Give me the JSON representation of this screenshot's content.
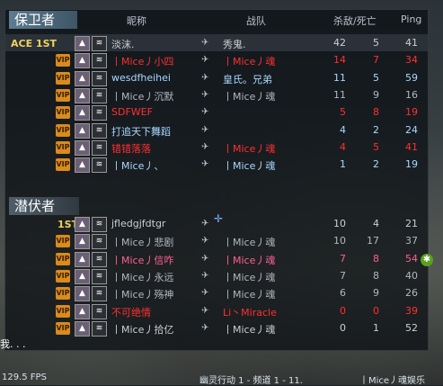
{
  "headers": {
    "nickname": "昵称",
    "clan": "战队",
    "kd": "杀敌/死亡",
    "ping": "Ping"
  },
  "teams": [
    {
      "title": "保卫者",
      "players": [
        {
          "prefix": "ACE 1ST",
          "name": "淡沫.",
          "clan": "秀鬼.",
          "k": "42",
          "d": "5",
          "p": "41",
          "color": "#c9cfd5",
          "hl": true
        },
        {
          "prefix": "",
          "name": "丨Mice丿小四",
          "clan": "丨Mice丿魂",
          "k": "14",
          "d": "7",
          "p": "34",
          "color": "#ff3030"
        },
        {
          "prefix": "",
          "name": "wesdfheihei",
          "clan": "皇氏。兄弟",
          "k": "11",
          "d": "5",
          "p": "59",
          "color": "#a8d8ff"
        },
        {
          "prefix": "",
          "name": "丨Mice丿沉默",
          "clan": "丨Mice丿魂",
          "k": "11",
          "d": "9",
          "p": "16",
          "color": "#b0b8c0"
        },
        {
          "prefix": "",
          "name": "SDFWEF",
          "clan": "",
          "k": "5",
          "d": "8",
          "p": "19",
          "color": "#ff3030"
        },
        {
          "prefix": "",
          "name": "打追天下舞蹈",
          "clan": "",
          "k": "4",
          "d": "2",
          "p": "24",
          "color": "#a8d8ff"
        },
        {
          "prefix": "",
          "name": "错错落落",
          "clan": "丨Mice丿魂",
          "k": "4",
          "d": "5",
          "p": "41",
          "color": "#ff3030"
        },
        {
          "prefix": "",
          "name": "丨Mice丿、",
          "clan": "丨Mice丿魂",
          "k": "1",
          "d": "2",
          "p": "19",
          "color": "#a8d8ff"
        }
      ]
    },
    {
      "title": "潜伏者",
      "players": [
        {
          "prefix": "1ST",
          "name": "jfledgjfdtgr",
          "clan": "",
          "k": "10",
          "d": "4",
          "p": "21",
          "color": "#c9cfd5"
        },
        {
          "prefix": "",
          "name": "丨Mice丿悲剧",
          "clan": "丨Mice丿魂",
          "k": "10",
          "d": "17",
          "p": "37",
          "color": "#b0b8c0"
        },
        {
          "prefix": "",
          "name": "丨Mice丿信咋",
          "clan": "丨Mice丿魂",
          "k": "7",
          "d": "8",
          "p": "54",
          "color": "#ff6090"
        },
        {
          "prefix": "",
          "name": "丨Mice丿永远",
          "clan": "丨Mice丿魂",
          "k": "7",
          "d": "8",
          "p": "40",
          "color": "#b0b8c0"
        },
        {
          "prefix": "",
          "name": "丨Mice丿殇神",
          "clan": "丨Mice丿魂",
          "k": "6",
          "d": "9",
          "p": "26",
          "color": "#b0b8c0"
        },
        {
          "prefix": "",
          "name": "不可绝情",
          "clan": "Li丶Miracle",
          "k": "0",
          "d": "0",
          "p": "39",
          "color": "#ff3030"
        },
        {
          "prefix": "",
          "name": "丨Mice丿拾亿",
          "clan": "丨Mice丿魂",
          "k": "0",
          "d": "1",
          "p": "52",
          "color": "#c9cfd5"
        }
      ]
    }
  ],
  "chat": {
    "text": "我. . ."
  },
  "status": {
    "fps": "129.5 FPS",
    "server": "幽灵行动 1 - 频道 1 - 11.",
    "owner": "丨Mice丿魂娱乐"
  }
}
